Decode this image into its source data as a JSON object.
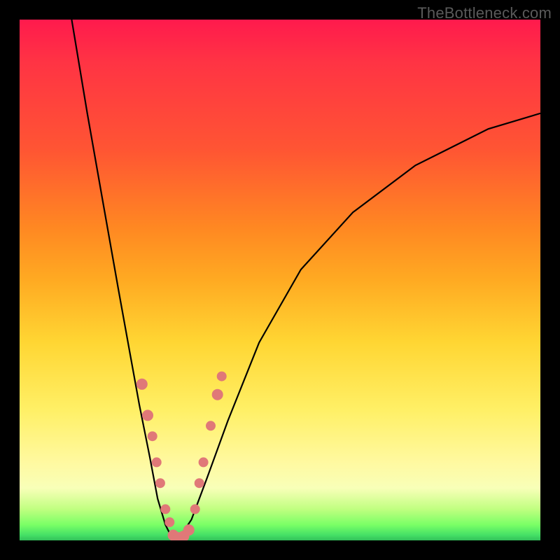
{
  "watermark": "TheBottleneck.com",
  "chart_data": {
    "type": "line",
    "title": "",
    "xlabel": "",
    "ylabel": "",
    "xlim": [
      0,
      100
    ],
    "ylim": [
      0,
      100
    ],
    "curve_left": {
      "x": [
        10,
        13,
        16,
        19,
        21,
        23,
        25,
        26.5,
        28,
        29,
        30
      ],
      "y": [
        100,
        82,
        65,
        48,
        37,
        26,
        16,
        8,
        3,
        1,
        0
      ]
    },
    "curve_right": {
      "x": [
        30,
        31,
        33,
        36,
        40,
        46,
        54,
        64,
        76,
        90,
        100
      ],
      "y": [
        0,
        1,
        4,
        12,
        23,
        38,
        52,
        63,
        72,
        79,
        82
      ]
    },
    "markers": [
      {
        "x": 23.5,
        "y": 30,
        "r": 8
      },
      {
        "x": 24.6,
        "y": 24,
        "r": 8
      },
      {
        "x": 25.5,
        "y": 20,
        "r": 7
      },
      {
        "x": 26.3,
        "y": 15,
        "r": 7
      },
      {
        "x": 27.0,
        "y": 11,
        "r": 7
      },
      {
        "x": 28.0,
        "y": 6,
        "r": 7
      },
      {
        "x": 28.8,
        "y": 3.5,
        "r": 7
      },
      {
        "x": 29.5,
        "y": 1,
        "r": 8
      },
      {
        "x": 30.5,
        "y": 0.5,
        "r": 8
      },
      {
        "x": 31.5,
        "y": 0.8,
        "r": 8
      },
      {
        "x": 32.5,
        "y": 2,
        "r": 8
      },
      {
        "x": 33.7,
        "y": 6,
        "r": 7
      },
      {
        "x": 34.5,
        "y": 11,
        "r": 7
      },
      {
        "x": 35.3,
        "y": 15,
        "r": 7
      },
      {
        "x": 36.7,
        "y": 22,
        "r": 7
      },
      {
        "x": 38.0,
        "y": 28,
        "r": 8
      },
      {
        "x": 38.8,
        "y": 31.5,
        "r": 7
      }
    ],
    "background_gradient": {
      "top": "#ff1a4d",
      "mid": "#ffd633",
      "bottom": "#33c059"
    }
  }
}
